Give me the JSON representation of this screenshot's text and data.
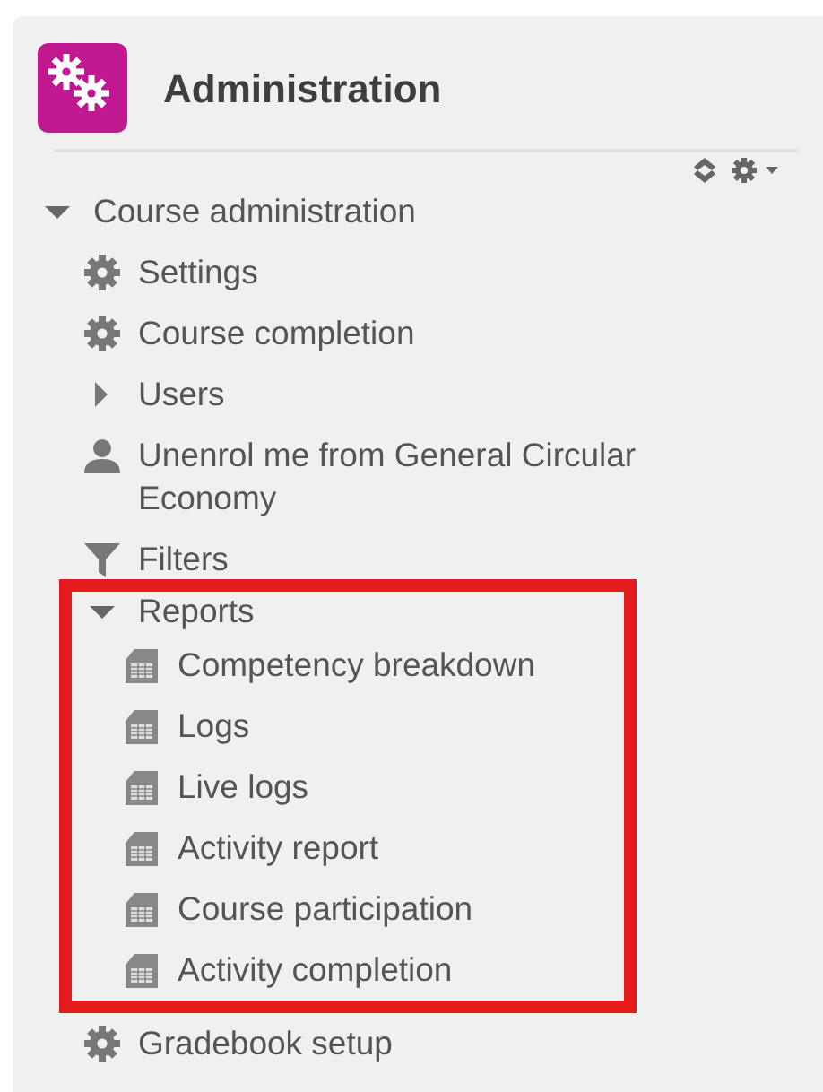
{
  "block": {
    "title": "Administration"
  },
  "tree": [
    {
      "label": "Course administration",
      "kind": "branch",
      "expanded": true,
      "highlighted": false,
      "children": [
        {
          "label": "Settings",
          "kind": "gear"
        },
        {
          "label": "Course completion",
          "kind": "gear"
        },
        {
          "label": "Users",
          "kind": "branch",
          "expanded": false,
          "highlighted": false
        },
        {
          "label": "Unenrol me from General Circular Economy",
          "kind": "user"
        },
        {
          "label": "Filters",
          "kind": "filter"
        },
        {
          "label": "Reports",
          "kind": "branch",
          "expanded": true,
          "highlighted": true,
          "children": [
            {
              "label": "Competency breakdown",
              "kind": "report"
            },
            {
              "label": "Logs",
              "kind": "report"
            },
            {
              "label": "Live logs",
              "kind": "report"
            },
            {
              "label": "Activity report",
              "kind": "report"
            },
            {
              "label": "Course participation",
              "kind": "report"
            },
            {
              "label": "Activity completion",
              "kind": "report"
            }
          ]
        },
        {
          "label": "Gradebook setup",
          "kind": "gear"
        }
      ]
    }
  ]
}
